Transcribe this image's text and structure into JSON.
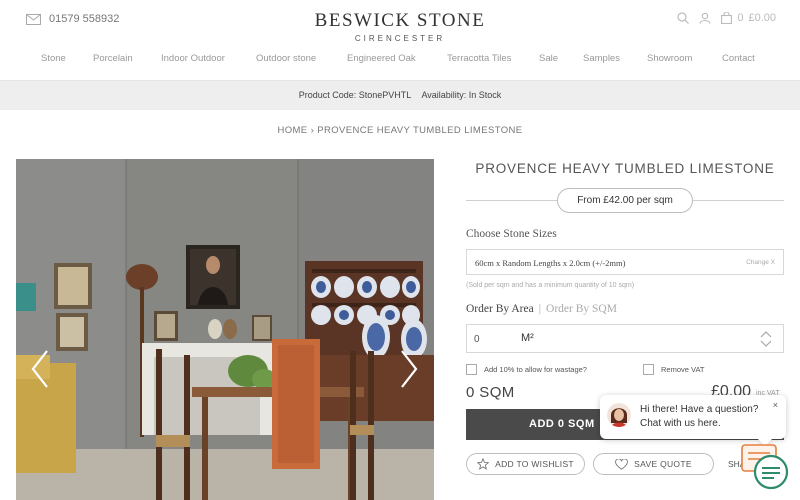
{
  "header": {
    "phone": "01579 558932",
    "logo_main": "BESWICK STONE",
    "logo_sub": "CIRENCESTER",
    "cart_count": "0",
    "cart_total": "£0.00"
  },
  "nav": {
    "items": [
      "Stone",
      "Porcelain",
      "Indoor Outdoor",
      "Outdoor stone",
      "Engineered Oak",
      "Terracotta Tiles",
      "Sale",
      "Samples",
      "Showroom",
      "Contact"
    ]
  },
  "product_bar": {
    "code": "Product Code: StonePVHTL",
    "availability": "Availability: In Stock"
  },
  "breadcrumb": {
    "home": "HOME",
    "separator": "›",
    "current": "PROVENCE HEAVY TUMBLED LIMESTONE"
  },
  "product": {
    "title": "PROVENCE HEAVY TUMBLED LIMESTONE",
    "price_from": "From £42.00 per sqm",
    "choose_label": "Choose Stone Sizes",
    "size_value": "60cm x Random Lengths x 2.0cm (+/-2mm)",
    "change_label": "Change X",
    "note": "(Sold per sqm and has a minimum quantity of 10 sqm)",
    "order_by_area": "Order By Area",
    "order_sep": "|",
    "order_by_sqm": "Order By SQM",
    "qty_value": "0",
    "qty_unit": "M²",
    "wastage_label": "Add 10% to allow for wastage?",
    "remove_vat_label": "Remove VAT",
    "sqm_total": "0 SQM",
    "price_total": "£0.00",
    "price_vat": "inc VAT",
    "add_button": "ADD 0 SQM",
    "wishlist_button": "ADD TO WISHLIST",
    "save_quote_button": "SAVE QUOTE",
    "share_label": "SHARE"
  },
  "chat": {
    "line1": "Hi there! Have a question?",
    "line2": "Chat with us here.",
    "close": "×"
  },
  "colors": {
    "button_dark": "#4a4a4a",
    "band_grey": "#eeeeee",
    "chat_accent": "#e87d3e",
    "chat_green": "#2e8b6e"
  },
  "icons": [
    "mail-icon",
    "search-icon",
    "user-icon",
    "cart-icon",
    "chevron-left-icon",
    "chevron-right-icon",
    "spinner-up-icon",
    "spinner-down-icon",
    "star-icon",
    "heart-icon",
    "close-icon",
    "chat-icon"
  ]
}
